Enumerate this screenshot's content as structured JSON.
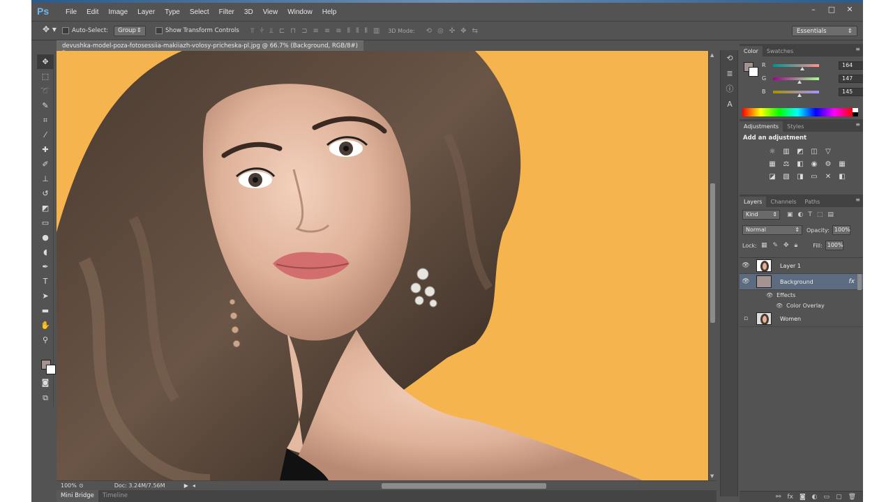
{
  "app": {
    "logo": "Ps",
    "menu": [
      "File",
      "Edit",
      "Image",
      "Layer",
      "Type",
      "Select",
      "Filter",
      "3D",
      "View",
      "Window",
      "Help"
    ],
    "window_controls": [
      "–",
      "□",
      "✕"
    ]
  },
  "options": {
    "auto_select_label": "Auto-Select:",
    "auto_select_value": "Group",
    "show_transform_label": "Show Transform Controls",
    "mode_3d_label": "3D Mode:",
    "workspace": "Essentials"
  },
  "document": {
    "tab_title": "devushka-model-poza-fotosessiia-makiiazh-volosy-pricheska-pl.jpg @ 66.7% (Background, RGB/8#) *",
    "zoom": "100%",
    "doc_size": "Doc: 3.24M/7.56M"
  },
  "bottom_tabs": [
    "Mini Bridge",
    "Timeline"
  ],
  "color_panel": {
    "tabs": [
      "Color",
      "Swatches"
    ],
    "fg_color": "#a49391",
    "channels": [
      {
        "label": "R",
        "value": "164",
        "fraction": 0.643
      },
      {
        "label": "G",
        "value": "147",
        "fraction": 0.576
      },
      {
        "label": "B",
        "value": "145",
        "fraction": 0.569
      }
    ]
  },
  "adjustments_panel": {
    "tabs": [
      "Adjustments",
      "Styles"
    ],
    "title": "Add an adjustment"
  },
  "layers_panel": {
    "tabs": [
      "Layers",
      "Channels",
      "Paths"
    ],
    "kind": "Kind",
    "blend_mode": "Normal",
    "opacity_label": "Opacity:",
    "opacity": "100%",
    "lock_label": "Lock:",
    "fill_label": "Fill:",
    "fill": "100%",
    "layers": [
      {
        "name": "Layer 1",
        "visible": true,
        "selected": false
      },
      {
        "name": "Background",
        "visible": true,
        "selected": true,
        "fx": "fx",
        "effects_label": "Effects",
        "effect": "Color Overlay"
      },
      {
        "name": "Women",
        "visible": false,
        "selected": false
      }
    ]
  },
  "colors": {
    "canvas_background": "#f6b44e",
    "ui_dark": "#535353",
    "selected_layer": "#5d6b80"
  }
}
